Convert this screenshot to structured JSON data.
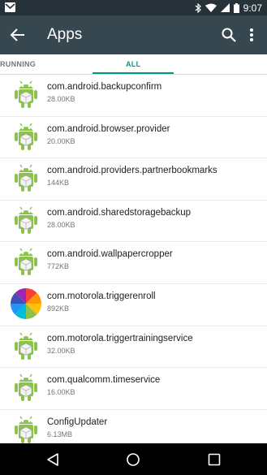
{
  "status_bar": {
    "time": "9:07",
    "icons": [
      "gmail-icon",
      "bluetooth-icon",
      "wifi-icon",
      "signal-icon",
      "battery-icon"
    ]
  },
  "app_bar": {
    "title": "Apps",
    "icons": [
      "back-arrow-icon",
      "search-icon",
      "overflow-menu-icon"
    ]
  },
  "tabs": [
    {
      "label": "RUNNING",
      "selected": false
    },
    {
      "label": "ALL",
      "selected": true
    }
  ],
  "colors": {
    "app_bar": "#37474f",
    "status_bar": "#263238",
    "accent": "#009688",
    "android_green": "#8bc34a"
  },
  "apps": [
    {
      "name": "com.android.backupconfirm",
      "size": "28.00KB",
      "icon": "android-robot-icon"
    },
    {
      "name": "com.android.browser.provider",
      "size": "20.00KB",
      "icon": "android-robot-icon"
    },
    {
      "name": "com.android.providers.partnerbookmarks",
      "size": "144KB",
      "icon": "android-robot-icon"
    },
    {
      "name": "com.android.sharedstoragebackup",
      "size": "28.00KB",
      "icon": "android-robot-icon"
    },
    {
      "name": "com.android.wallpapercropper",
      "size": "772KB",
      "icon": "android-robot-icon"
    },
    {
      "name": "com.motorola.triggerenroll",
      "size": "892KB",
      "icon": "motorola-pinwheel-icon"
    },
    {
      "name": "com.motorola.triggertrainingservice",
      "size": "32.00KB",
      "icon": "android-robot-icon"
    },
    {
      "name": "com.qualcomm.timeservice",
      "size": "16.00KB",
      "icon": "android-robot-icon"
    },
    {
      "name": "ConfigUpdater",
      "size": "6.13MB",
      "icon": "android-robot-icon"
    }
  ],
  "nav_bar": {
    "icons": [
      "nav-back-icon",
      "nav-home-icon",
      "nav-recents-icon"
    ]
  }
}
